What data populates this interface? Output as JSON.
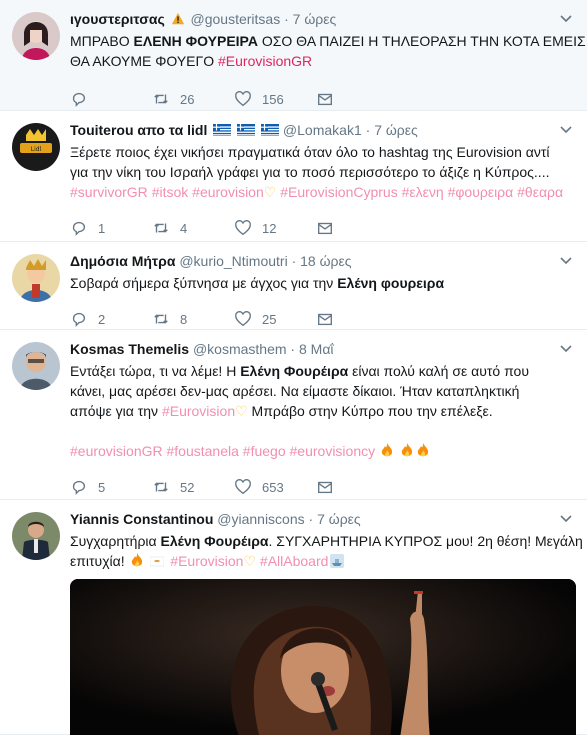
{
  "tweets": [
    {
      "name": "ιγουστεριτσας",
      "handle": "@gousteritsas",
      "time": "7 ώρες",
      "line1_a": "ΜΠΡΑΒΟ ",
      "line1_bold": "ΕΛΕΝΗ ΦΟΥΡΕΙΡΑ",
      "line1_b": " ΟΣΟ ΘΑ ΠΑΙΖΕΙ Η ΤΗΛΕΟΡΑΣΗ ΤΗΝ ΚΟΤΑ ΕΜΕΙΣ",
      "line2_a": "ΘΑ ΑΚΟΥΜΕ ΦΟΥΕΓΟ ",
      "line2_tag": "#EurovisionGR",
      "replies": "",
      "retweets": "26",
      "likes": "156"
    },
    {
      "name": "Touiterou απο τα lidl",
      "handle": "@Lomakak1",
      "time": "7 ώρες",
      "line1": "Ξέρετε ποιος έχει νικήσει πραγματικά όταν όλο το hashtag της Eurovision αντί",
      "line2": "για την νίκη του Ισραήλ γράφει για το ποσό περισσότερο το άξιζε η Κύπρος....",
      "tags": [
        "#survivorGR",
        "#itsok",
        "#eurovision",
        "#EurovisionCyprus",
        "#ελενη",
        "#φουρειρα",
        "#θεαρα"
      ],
      "replies": "1",
      "retweets": "4",
      "likes": "12"
    },
    {
      "name": "Δημόσια Μήτρα",
      "handle": "@kurio_Ntimoutri",
      "time": "18 ώρες",
      "line1_a": "Σοβαρά σήμερα ξύπνησα με άγχος για την ",
      "line1_bold": "Ελένη φουρειρα",
      "replies": "2",
      "retweets": "8",
      "likes": "25"
    },
    {
      "name": "Kosmas Themelis",
      "handle": "@kosmasthem",
      "time": "8 Μαΐ",
      "line1_a": "Εντάξει τώρα, τι να λέμε! Η ",
      "line1_bold": "Ελένη Φουρέιρα",
      "line1_b": " είναι πολύ καλή σε αυτό που",
      "line2": "κάνει, μας αρέσει δεν-μας αρέσει. Να είμαστε δίκαιοι. Ήταν καταπληκτική",
      "line3_a": "απόψε για την ",
      "line3_tag": "#Eurovision",
      "line3_b": " Μπράβο στην Κύπρο που την επέλεξε.",
      "tags": [
        "#eurovisionGR",
        "#foustanela",
        "#fuego",
        "#eurovisioncy"
      ],
      "replies": "5",
      "retweets": "52",
      "likes": "653"
    },
    {
      "name": "Yiannis Constantinou",
      "handle": "@yianniscons",
      "time": "7 ώρες",
      "line1_a": "Συγχαρητήρια ",
      "line1_bold": "Ελένη Φουρέιρα",
      "line1_b": ". ΣΥΓΧΑΡΗΤΗΡΙΑ ΚΥΠΡΟΣ μου! 2η θέση! Μεγάλη",
      "line2_a": "επιτυχία! ",
      "tag_a": "#Eurovision",
      "tag_b": "#AllAboard"
    }
  ],
  "icons": {
    "reply": "reply-icon",
    "retweet": "retweet-icon",
    "like": "heart-icon",
    "dm": "envelope-icon",
    "caret": "chevron-down-icon"
  },
  "colors": {
    "hashtag": "#e0245e",
    "muted": "#657786",
    "background": "#e6ecf0"
  }
}
